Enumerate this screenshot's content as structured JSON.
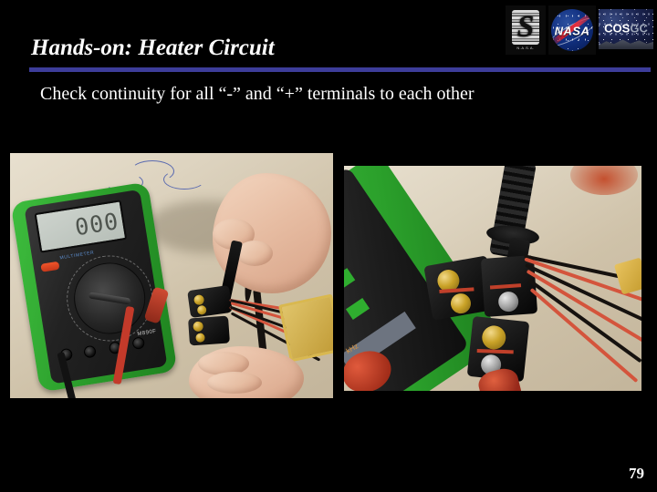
{
  "slide": {
    "background_color": "#000000",
    "title": "Hands-on: Heater Circuit",
    "rule_color": "#3d3d9a",
    "body_text": "Check continuity for all “-” and “+” terminals to each other",
    "page_number": "79"
  },
  "logos": [
    {
      "name": "silver-striped-logo",
      "caption": "N.A.S.A.",
      "letter": "S"
    },
    {
      "name": "nasa-meatball-logo",
      "text": "NASA"
    },
    {
      "name": "cosgc-logo",
      "text_primary": "COS",
      "text_secondary": "GC"
    }
  ],
  "photos": {
    "left": {
      "caption": "Green-cased digital multimeter on a table with hands holding black and red test probes against a battery-snap terminal block",
      "multimeter": {
        "display_value": "000",
        "brand_text": "MULTIMETER",
        "model_text": "M890F"
      }
    },
    "right": {
      "caption": "Close-up of black and red multimeter probes touching brass screw terminals of battery snap connectors with red and black wires"
    }
  }
}
